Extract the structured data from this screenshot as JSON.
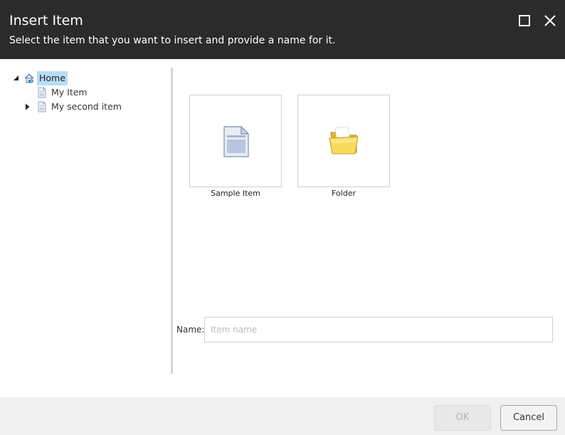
{
  "dialog": {
    "title": "Insert Item",
    "subtitle": "Select the item that you want to insert and provide a name for it."
  },
  "header_buttons": {
    "maximize_icon": "maximize-icon",
    "close_icon": "close-icon"
  },
  "tree": {
    "items": [
      {
        "label": "Home",
        "icon": "home-icon",
        "expanded": true,
        "selected": true
      },
      {
        "label": "My Item",
        "icon": "document-icon",
        "has_children": false
      },
      {
        "label": "My second item",
        "icon": "document-icon",
        "has_children": true,
        "expanded": false
      }
    ]
  },
  "templates": [
    {
      "label": "Sample Item",
      "icon": "sample-item-icon"
    },
    {
      "label": "Folder",
      "icon": "folder-icon"
    }
  ],
  "name_field": {
    "label": "Name:",
    "value": "",
    "placeholder": "Item name"
  },
  "footer": {
    "ok_label": "OK",
    "ok_disabled": true,
    "cancel_label": "Cancel"
  },
  "colors": {
    "header_bg": "#2b2b2b",
    "selection": "#b7dcf5",
    "footer_bg": "#f0f0f0"
  }
}
